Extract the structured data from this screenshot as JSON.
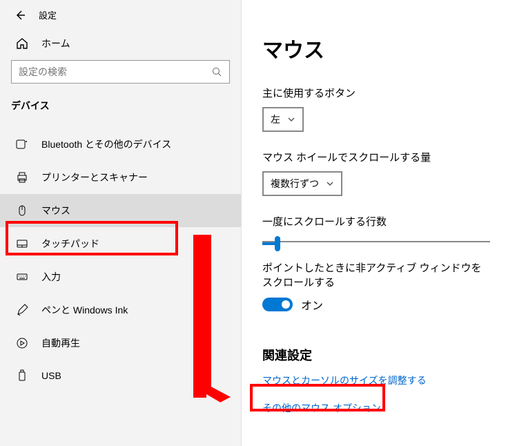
{
  "titlebar": {
    "label": "設定"
  },
  "home": {
    "label": "ホーム"
  },
  "search": {
    "placeholder": "設定の検索"
  },
  "category": "デバイス",
  "nav": [
    {
      "label": "Bluetooth とその他のデバイス",
      "icon": "bluetooth"
    },
    {
      "label": "プリンターとスキャナー",
      "icon": "printer"
    },
    {
      "label": "マウス",
      "icon": "mouse",
      "selected": true
    },
    {
      "label": "タッチパッド",
      "icon": "touchpad"
    },
    {
      "label": "入力",
      "icon": "keyboard"
    },
    {
      "label": "ペンと Windows Ink",
      "icon": "pen"
    },
    {
      "label": "自動再生",
      "icon": "autoplay"
    },
    {
      "label": "USB",
      "icon": "usb"
    }
  ],
  "main": {
    "title": "マウス",
    "primary_button": {
      "label": "主に使用するボタン",
      "value": "左"
    },
    "wheel_scroll": {
      "label": "マウス ホイールでスクロールする量",
      "value": "複数行ずつ"
    },
    "lines_label": "一度にスクロールする行数",
    "inactive_scroll": {
      "label": "ポイントしたときに非アクティブ ウィンドウをスクロールする",
      "state": "オン"
    },
    "related": {
      "heading": "関連設定",
      "link_cursor": "マウスとカーソルのサイズを調整する",
      "link_extra": "その他のマウス オプション"
    }
  }
}
